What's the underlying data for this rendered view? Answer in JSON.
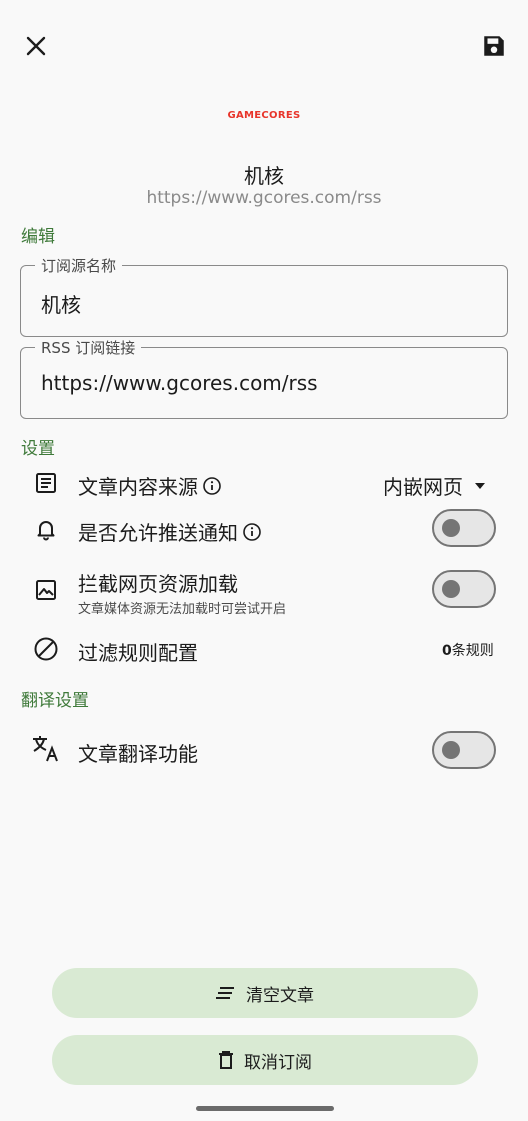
{
  "header": {
    "close_icon": "close-icon",
    "save_icon": "save-icon"
  },
  "feed": {
    "logo_text": "GAMECORES",
    "name": "机核",
    "url": "https://www.gcores.com/rss"
  },
  "edit_section": {
    "title": "编辑",
    "name_field": {
      "label": "订阅源名称",
      "value": "机核"
    },
    "url_field": {
      "label": "RSS 订阅链接",
      "value": "https://www.gcores.com/rss"
    }
  },
  "settings_section": {
    "title": "设置",
    "content_source": {
      "label": "文章内容来源",
      "value": "内嵌网页"
    },
    "push_notify": {
      "label": "是否允许推送通知",
      "enabled": false
    },
    "block_resources": {
      "label": "拦截网页资源加载",
      "sub": "文章媒体资源无法加载时可尝试开启",
      "enabled": false
    },
    "filter_rules": {
      "label": "过滤规则配置",
      "count": "0",
      "count_suffix": "条规则"
    }
  },
  "translate_section": {
    "title": "翻译设置",
    "translate": {
      "label": "文章翻译功能",
      "enabled": false
    }
  },
  "actions": {
    "clear_label": "清空文章",
    "unsubscribe_label": "取消订阅"
  },
  "colors": {
    "accent": "#3f7a3a",
    "logo_red": "#e8352b",
    "pill_bg": "#d9ead3"
  }
}
